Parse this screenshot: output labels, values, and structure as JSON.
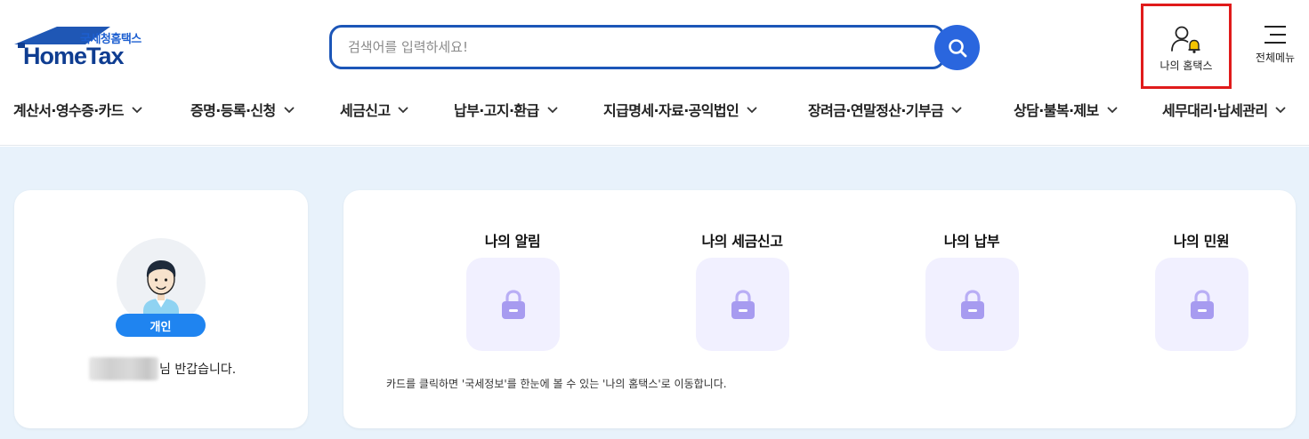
{
  "logo": {
    "sub_text": "국세청홈택스",
    "main_text": "HomeTax"
  },
  "search": {
    "placeholder": "검색어를 입력하세요!"
  },
  "header_actions": {
    "my_hometax_label": "나의 홈택스",
    "all_menu_label": "전체메뉴"
  },
  "gnb": [
    "계산서·영수증·카드",
    "증명·등록·신청",
    "세금신고",
    "납부·고지·환급",
    "지급명세·자료·공익법인",
    "장려금·연말정산·기부금",
    "상담·불복·제보",
    "세무대리·납세관리"
  ],
  "profile": {
    "badge": "개인",
    "greeting_suffix": "님 반갑습니다."
  },
  "cards": [
    {
      "title": "나의 알림"
    },
    {
      "title": "나의 세금신고"
    },
    {
      "title": "나의 납부"
    },
    {
      "title": "나의 민원"
    }
  ],
  "hint": "카드를 클릭하면 '국세정보'를 한눈에 볼 수 있는 '나의 홈택스'로 이동합니다.",
  "colors": {
    "brand_blue": "#1c56b8",
    "search_button": "#2a66de",
    "badge_blue": "#1f84f0",
    "highlight_red": "#e01b1b",
    "lock_purple": "#a79bf0",
    "card_bg": "#f1f0ff",
    "page_bg": "#e8f2fb"
  },
  "icons": {
    "search_button": "search-icon",
    "my_hometax": "user-bell-icon",
    "all_menu": "hamburger-icon",
    "gnb_chevron": "chevron-down-icon",
    "card": "lock-icon"
  }
}
